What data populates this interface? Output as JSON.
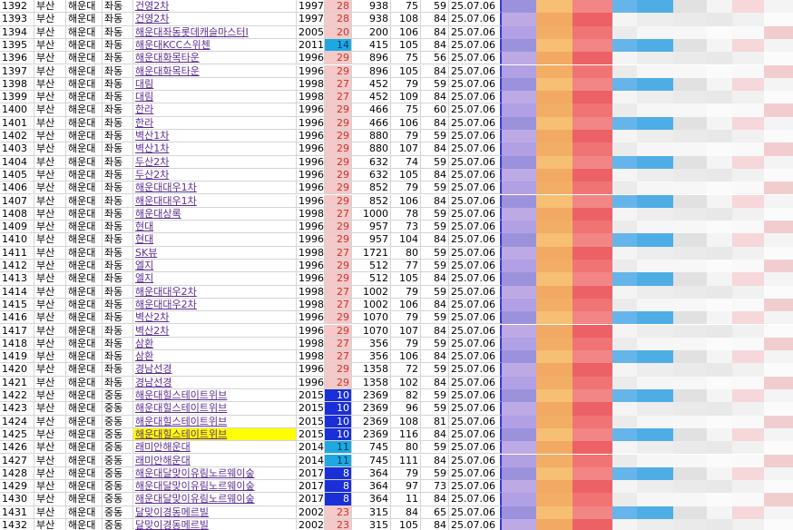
{
  "columns_note": "",
  "rows": [
    {
      "no": "1392",
      "city": "부산",
      "gu": "해운대",
      "dong": "좌동",
      "name": "건영2차",
      "year": "1997",
      "age": "28",
      "age_style": "pink",
      "a": "938",
      "b": "75",
      "c": "59",
      "date": "25.07.06",
      "link": "purple",
      "hl": false
    },
    {
      "no": "1393",
      "city": "부산",
      "gu": "해운대",
      "dong": "좌동",
      "name": "건영2차",
      "year": "1997",
      "age": "28",
      "age_style": "pink",
      "a": "938",
      "b": "108",
      "c": "84",
      "date": "25.07.06",
      "link": "purple",
      "hl": false
    },
    {
      "no": "1394",
      "city": "부산",
      "gu": "해운대",
      "dong": "좌동",
      "name": "해운대좌동롯데캐슬마스터I",
      "year": "2005",
      "age": "20",
      "age_style": "pink",
      "a": "200",
      "b": "106",
      "c": "84",
      "date": "25.07.06",
      "link": "purple",
      "hl": false
    },
    {
      "no": "1395",
      "city": "부산",
      "gu": "해운대",
      "dong": "좌동",
      "name": "해운대KCC스위첸",
      "year": "2011",
      "age": "14",
      "age_style": "cyan",
      "a": "415",
      "b": "105",
      "c": "84",
      "date": "25.07.06",
      "link": "purple",
      "hl": false
    },
    {
      "no": "1396",
      "city": "부산",
      "gu": "해운대",
      "dong": "좌동",
      "name": "해운대화목타운",
      "year": "1996",
      "age": "29",
      "age_style": "pink",
      "a": "896",
      "b": "75",
      "c": "56",
      "date": "25.07.06",
      "link": "purple",
      "hl": false
    },
    {
      "no": "1397",
      "city": "부산",
      "gu": "해운대",
      "dong": "좌동",
      "name": "해운대화목타운",
      "year": "1996",
      "age": "29",
      "age_style": "pink",
      "a": "896",
      "b": "105",
      "c": "84",
      "date": "25.07.06",
      "link": "purple",
      "hl": false
    },
    {
      "no": "1398",
      "city": "부산",
      "gu": "해운대",
      "dong": "좌동",
      "name": "대림",
      "year": "1998",
      "age": "27",
      "age_style": "pink",
      "a": "452",
      "b": "79",
      "c": "59",
      "date": "25.07.06",
      "link": "purple",
      "hl": false
    },
    {
      "no": "1399",
      "city": "부산",
      "gu": "해운대",
      "dong": "좌동",
      "name": "대림",
      "year": "1998",
      "age": "27",
      "age_style": "pink",
      "a": "452",
      "b": "109",
      "c": "84",
      "date": "25.07.06",
      "link": "purple",
      "hl": false
    },
    {
      "no": "1400",
      "city": "부산",
      "gu": "해운대",
      "dong": "좌동",
      "name": "한라",
      "year": "1996",
      "age": "29",
      "age_style": "pink",
      "a": "466",
      "b": "75",
      "c": "60",
      "date": "25.07.06",
      "link": "purple",
      "hl": false
    },
    {
      "no": "1401",
      "city": "부산",
      "gu": "해운대",
      "dong": "좌동",
      "name": "한라",
      "year": "1996",
      "age": "29",
      "age_style": "pink",
      "a": "466",
      "b": "106",
      "c": "84",
      "date": "25.07.06",
      "link": "purple",
      "hl": false
    },
    {
      "no": "1402",
      "city": "부산",
      "gu": "해운대",
      "dong": "좌동",
      "name": "벽산1차",
      "year": "1996",
      "age": "29",
      "age_style": "pink",
      "a": "880",
      "b": "79",
      "c": "59",
      "date": "25.07.06",
      "link": "purple",
      "hl": false
    },
    {
      "no": "1403",
      "city": "부산",
      "gu": "해운대",
      "dong": "좌동",
      "name": "벽산1차",
      "year": "1996",
      "age": "29",
      "age_style": "pink",
      "a": "880",
      "b": "107",
      "c": "84",
      "date": "25.07.06",
      "link": "purple",
      "hl": false
    },
    {
      "no": "1404",
      "city": "부산",
      "gu": "해운대",
      "dong": "좌동",
      "name": "두산2차",
      "year": "1996",
      "age": "29",
      "age_style": "pink",
      "a": "632",
      "b": "74",
      "c": "59",
      "date": "25.07.06",
      "link": "purple",
      "hl": false
    },
    {
      "no": "1405",
      "city": "부산",
      "gu": "해운대",
      "dong": "좌동",
      "name": "두산2차",
      "year": "1996",
      "age": "29",
      "age_style": "pink",
      "a": "632",
      "b": "105",
      "c": "84",
      "date": "25.07.06",
      "link": "purple",
      "hl": false
    },
    {
      "no": "1406",
      "city": "부산",
      "gu": "해운대",
      "dong": "좌동",
      "name": "해운대대우1차",
      "year": "1996",
      "age": "29",
      "age_style": "pink",
      "a": "852",
      "b": "79",
      "c": "59",
      "date": "25.07.06",
      "link": "purple",
      "hl": false
    },
    {
      "no": "1407",
      "city": "부산",
      "gu": "해운대",
      "dong": "좌동",
      "name": "해운대대우1차",
      "year": "1996",
      "age": "29",
      "age_style": "pink",
      "a": "852",
      "b": "106",
      "c": "84",
      "date": "25.07.06",
      "link": "purple",
      "hl": false
    },
    {
      "no": "1408",
      "city": "부산",
      "gu": "해운대",
      "dong": "좌동",
      "name": "해운대상록",
      "year": "1998",
      "age": "27",
      "age_style": "pink",
      "a": "1000",
      "b": "78",
      "c": "59",
      "date": "25.07.06",
      "link": "purple",
      "hl": false
    },
    {
      "no": "1409",
      "city": "부산",
      "gu": "해운대",
      "dong": "좌동",
      "name": "현대",
      "year": "1996",
      "age": "29",
      "age_style": "pink",
      "a": "957",
      "b": "73",
      "c": "59",
      "date": "25.07.06",
      "link": "purple",
      "hl": false
    },
    {
      "no": "1410",
      "city": "부산",
      "gu": "해운대",
      "dong": "좌동",
      "name": "현대",
      "year": "1996",
      "age": "29",
      "age_style": "pink",
      "a": "957",
      "b": "104",
      "c": "84",
      "date": "25.07.06",
      "link": "purple",
      "hl": false
    },
    {
      "no": "1411",
      "city": "부산",
      "gu": "해운대",
      "dong": "좌동",
      "name": "SK뷰",
      "year": "1998",
      "age": "27",
      "age_style": "pink",
      "a": "1721",
      "b": "80",
      "c": "59",
      "date": "25.07.06",
      "link": "purple",
      "hl": false
    },
    {
      "no": "1412",
      "city": "부산",
      "gu": "해운대",
      "dong": "좌동",
      "name": "엘지",
      "year": "1996",
      "age": "29",
      "age_style": "pink",
      "a": "512",
      "b": "77",
      "c": "59",
      "date": "25.07.06",
      "link": "purple",
      "hl": false
    },
    {
      "no": "1413",
      "city": "부산",
      "gu": "해운대",
      "dong": "좌동",
      "name": "엘지",
      "year": "1996",
      "age": "29",
      "age_style": "pink",
      "a": "512",
      "b": "105",
      "c": "84",
      "date": "25.07.06",
      "link": "purple",
      "hl": false
    },
    {
      "no": "1414",
      "city": "부산",
      "gu": "해운대",
      "dong": "좌동",
      "name": "해운대대우2차",
      "year": "1998",
      "age": "27",
      "age_style": "pink",
      "a": "1002",
      "b": "79",
      "c": "59",
      "date": "25.07.06",
      "link": "purple",
      "hl": false
    },
    {
      "no": "1415",
      "city": "부산",
      "gu": "해운대",
      "dong": "좌동",
      "name": "해운대대우2차",
      "year": "1998",
      "age": "27",
      "age_style": "pink",
      "a": "1002",
      "b": "106",
      "c": "84",
      "date": "25.07.06",
      "link": "purple",
      "hl": false
    },
    {
      "no": "1416",
      "city": "부산",
      "gu": "해운대",
      "dong": "좌동",
      "name": "벽산2차",
      "year": "1996",
      "age": "29",
      "age_style": "pink",
      "a": "1070",
      "b": "79",
      "c": "59",
      "date": "25.07.06",
      "link": "purple",
      "hl": false
    },
    {
      "no": "1417",
      "city": "부산",
      "gu": "해운대",
      "dong": "좌동",
      "name": "벽산2차",
      "year": "1996",
      "age": "29",
      "age_style": "pink",
      "a": "1070",
      "b": "107",
      "c": "84",
      "date": "25.07.06",
      "link": "purple",
      "hl": false
    },
    {
      "no": "1418",
      "city": "부산",
      "gu": "해운대",
      "dong": "좌동",
      "name": "삼환",
      "year": "1998",
      "age": "27",
      "age_style": "pink",
      "a": "356",
      "b": "79",
      "c": "59",
      "date": "25.07.06",
      "link": "purple",
      "hl": false
    },
    {
      "no": "1419",
      "city": "부산",
      "gu": "해운대",
      "dong": "좌동",
      "name": "삼환",
      "year": "1998",
      "age": "27",
      "age_style": "pink",
      "a": "356",
      "b": "106",
      "c": "84",
      "date": "25.07.06",
      "link": "purple",
      "hl": false
    },
    {
      "no": "1420",
      "city": "부산",
      "gu": "해운대",
      "dong": "좌동",
      "name": "경남선경",
      "year": "1996",
      "age": "29",
      "age_style": "pink",
      "a": "1358",
      "b": "72",
      "c": "59",
      "date": "25.07.06",
      "link": "purple",
      "hl": false
    },
    {
      "no": "1421",
      "city": "부산",
      "gu": "해운대",
      "dong": "좌동",
      "name": "경남선경",
      "year": "1996",
      "age": "29",
      "age_style": "pink",
      "a": "1358",
      "b": "102",
      "c": "84",
      "date": "25.07.06",
      "link": "purple",
      "hl": false
    },
    {
      "no": "1422",
      "city": "부산",
      "gu": "해운대",
      "dong": "중동",
      "name": "해운대힐스테이트위브",
      "year": "2015",
      "age": "10",
      "age_style": "blue",
      "a": "2369",
      "b": "82",
      "c": "59",
      "date": "25.07.06",
      "link": "purple",
      "hl": false
    },
    {
      "no": "1423",
      "city": "부산",
      "gu": "해운대",
      "dong": "중동",
      "name": "해운대힐스테이트위브",
      "year": "2015",
      "age": "10",
      "age_style": "blue",
      "a": "2369",
      "b": "96",
      "c": "59",
      "date": "25.07.06",
      "link": "purple",
      "hl": false
    },
    {
      "no": "1424",
      "city": "부산",
      "gu": "해운대",
      "dong": "중동",
      "name": "해운대힐스테이트위브",
      "year": "2015",
      "age": "10",
      "age_style": "blue",
      "a": "2369",
      "b": "108",
      "c": "81",
      "date": "25.07.06",
      "link": "purple",
      "hl": false
    },
    {
      "no": "1425",
      "city": "부산",
      "gu": "해운대",
      "dong": "중동",
      "name": "해운대힐스테이트위브",
      "year": "2015",
      "age": "10",
      "age_style": "blue",
      "a": "2369",
      "b": "116",
      "c": "84",
      "date": "25.07.06",
      "link": "purple",
      "hl": true
    },
    {
      "no": "1426",
      "city": "부산",
      "gu": "해운대",
      "dong": "중동",
      "name": "래미안해운대",
      "year": "2014",
      "age": "11",
      "age_style": "cyan",
      "a": "745",
      "b": "80",
      "c": "59",
      "date": "25.07.06",
      "link": "purple",
      "hl": false
    },
    {
      "no": "1427",
      "city": "부산",
      "gu": "해운대",
      "dong": "중동",
      "name": "래미안해운대",
      "year": "2014",
      "age": "11",
      "age_style": "cyan",
      "a": "745",
      "b": "111",
      "c": "84",
      "date": "25.07.06",
      "link": "purple",
      "hl": false
    },
    {
      "no": "1428",
      "city": "부산",
      "gu": "해운대",
      "dong": "중동",
      "name": "해운대달맞이유림노르웨이숲",
      "year": "2017",
      "age": "8",
      "age_style": "blue",
      "a": "364",
      "b": "79",
      "c": "59",
      "date": "25.07.06",
      "link": "purple",
      "hl": false
    },
    {
      "no": "1429",
      "city": "부산",
      "gu": "해운대",
      "dong": "중동",
      "name": "해운대달맞이유림노르웨이숲",
      "year": "2017",
      "age": "8",
      "age_style": "blue",
      "a": "364",
      "b": "97",
      "c": "73",
      "date": "25.07.06",
      "link": "purple",
      "hl": false
    },
    {
      "no": "1430",
      "city": "부산",
      "gu": "해운대",
      "dong": "중동",
      "name": "해운대달맞이유림노르웨이숲",
      "year": "2017",
      "age": "8",
      "age_style": "blue",
      "a": "364",
      "b": "11",
      "c": "84",
      "date": "25.07.06",
      "link": "purple",
      "hl": false
    },
    {
      "no": "1431",
      "city": "부산",
      "gu": "해운대",
      "dong": "중동",
      "name": "달맞이경동메르빌",
      "year": "2002",
      "age": "23",
      "age_style": "pink",
      "a": "315",
      "b": "84",
      "c": "65",
      "date": "25.07.06",
      "link": "purple",
      "hl": false
    },
    {
      "no": "1432",
      "city": "부산",
      "gu": "해운대",
      "dong": "중동",
      "name": "달맞이경동메르빌",
      "year": "2002",
      "age": "23",
      "age_style": "pink",
      "a": "315",
      "b": "105",
      "c": "84",
      "date": "25.07.06",
      "link": "purple",
      "hl": false
    }
  ],
  "colors": {
    "grid": "#d4d4d4",
    "highlight": "#ffff00",
    "age_pink": "#f6c8c8",
    "age_cyan": "#1fa8e0",
    "age_blue": "#1a2fd6"
  }
}
